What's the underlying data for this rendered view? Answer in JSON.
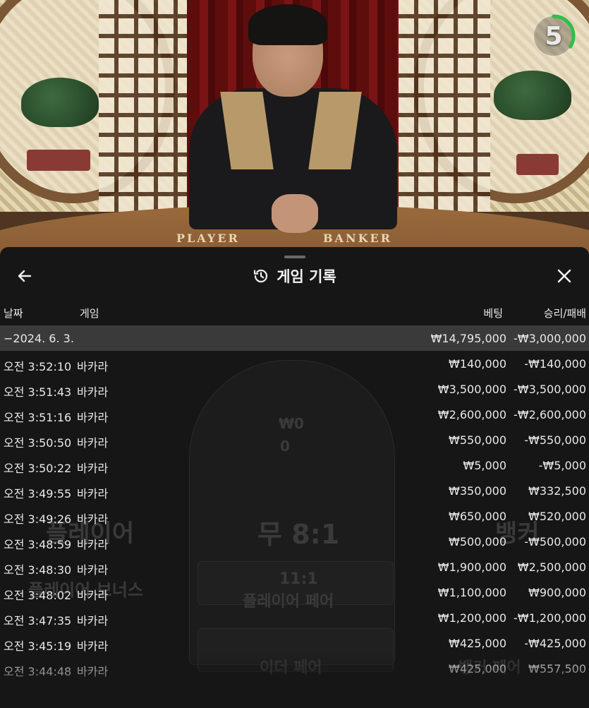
{
  "timer": {
    "value": "5"
  },
  "table_labels": {
    "player": "PLAYER",
    "banker": "BANKER"
  },
  "header": {
    "title": "게임 기록",
    "back_icon": "arrow-left-icon",
    "close_icon": "close-icon",
    "history_icon": "history-icon"
  },
  "columns": {
    "date": "날짜",
    "game": "게임",
    "bet": "베팅",
    "result": "승리/패배"
  },
  "date_row": {
    "label": "−2024. 6. 3.",
    "bet": "₩14,795,000",
    "result": "-₩3,000,000"
  },
  "rows": [
    {
      "time": "오전 3:52:10",
      "game": "바카라",
      "bet": "₩140,000",
      "result": "-₩140,000"
    },
    {
      "time": "오전 3:51:43",
      "game": "바카라",
      "bet": "₩3,500,000",
      "result": "-₩3,500,000"
    },
    {
      "time": "오전 3:51:16",
      "game": "바카라",
      "bet": "₩2,600,000",
      "result": "-₩2,600,000"
    },
    {
      "time": "오전 3:50:50",
      "game": "바카라",
      "bet": "₩550,000",
      "result": "-₩550,000"
    },
    {
      "time": "오전 3:50:22",
      "game": "바카라",
      "bet": "₩5,000",
      "result": "-₩5,000"
    },
    {
      "time": "오전 3:49:55",
      "game": "바카라",
      "bet": "₩350,000",
      "result": "₩332,500"
    },
    {
      "time": "오전 3:49:26",
      "game": "바카라",
      "bet": "₩650,000",
      "result": "₩520,000"
    },
    {
      "time": "오전 3:48:59",
      "game": "바카라",
      "bet": "₩500,000",
      "result": "-₩500,000"
    },
    {
      "time": "오전 3:48:30",
      "game": "바카라",
      "bet": "₩1,900,000",
      "result": "₩2,500,000"
    },
    {
      "time": "오전 3:48:02",
      "game": "바카라",
      "bet": "₩1,100,000",
      "result": "₩900,000"
    },
    {
      "time": "오전 3:47:35",
      "game": "바카라",
      "bet": "₩1,200,000",
      "result": "-₩1,200,000"
    },
    {
      "time": "오전 3:45:19",
      "game": "바카라",
      "bet": "₩425,000",
      "result": "-₩425,000"
    },
    {
      "time": "오전 3:44:48",
      "game": "바카라",
      "bet": "₩425,000",
      "result": "₩557,500"
    }
  ],
  "background_layer": {
    "tie": "무 8:1",
    "player": "플레이어",
    "banker": "뱅커",
    "player_bonus": "플레이어 보너스",
    "player_pair_odds": "11:1",
    "player_pair": "플레이어 페어",
    "either_pair": "이더 페어",
    "banker_pair": "뱅커 페어",
    "amount_a": "₩0",
    "amount_b": "0"
  },
  "colors": {
    "timer_ring": "#2fbf4a",
    "background": "#161616",
    "date_row": "#3a3a3a"
  }
}
